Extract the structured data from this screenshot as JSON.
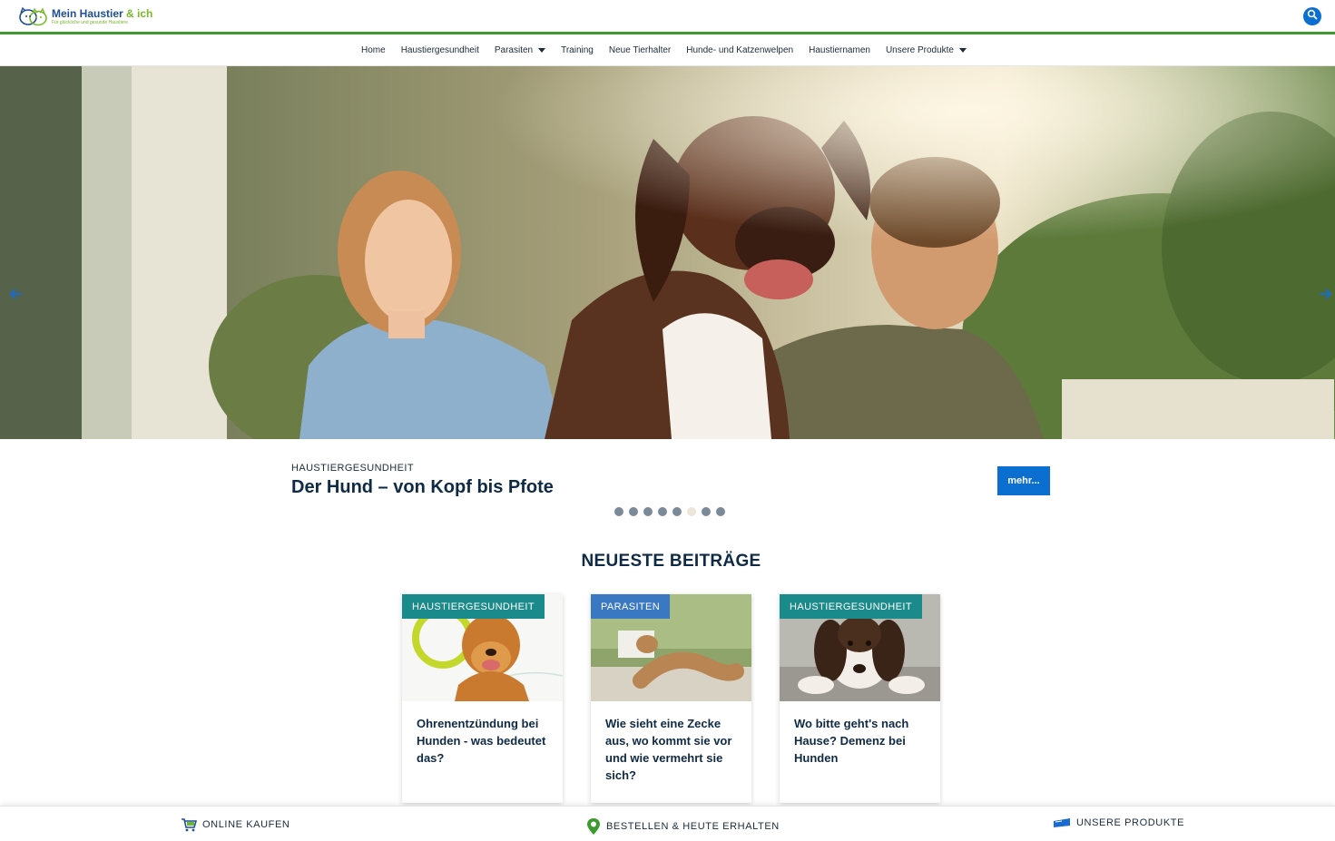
{
  "header": {
    "logo_title": "Mein Haustier",
    "logo_amp": "& ich",
    "logo_tagline": "Für glückliche und gesunde Haustiere"
  },
  "nav": {
    "items": [
      {
        "label": "Home"
      },
      {
        "label": "Haustiergesundheit"
      },
      {
        "label": "Parasiten"
      },
      {
        "label": "Training"
      },
      {
        "label": "Neue Tierhalter"
      },
      {
        "label": "Hunde- und Katzenwelpen"
      },
      {
        "label": "Haustiernamen"
      },
      {
        "label": "Unsere Produkte"
      }
    ]
  },
  "hero": {
    "category": "HAUSTIERGESUNDHEIT",
    "title": "Der Hund – von Kopf bis Pfote",
    "more_label": "mehr...",
    "slide_count": 8,
    "active_slide": 6
  },
  "latest": {
    "title": "NEUESTE BEITRÄGE",
    "cards": [
      {
        "category": "HAUSTIERGESUNDHEIT",
        "title": "Ohrenentzündung bei Hunden - was bedeutet das?"
      },
      {
        "category": "PARASITEN",
        "title": "Wie sieht eine Zecke aus, wo kommt sie vor und wie vermehrt sie sich?"
      },
      {
        "category": "HAUSTIERGESUNDHEIT",
        "title": "Wo bitte geht's nach Hause? Demenz bei Hunden"
      }
    ]
  },
  "footer": {
    "online": "ONLINE KAUFEN",
    "order": "BESTELLEN & HEUTE ERHALTEN",
    "products": "UNSERE PRODUKTE"
  },
  "colors": {
    "brand_blue": "#0a6fd1",
    "brand_green": "#3d9a2e",
    "badge_teal": "#1b8a8a",
    "badge_blue": "#3a78c2",
    "heading": "#0f2a44"
  }
}
